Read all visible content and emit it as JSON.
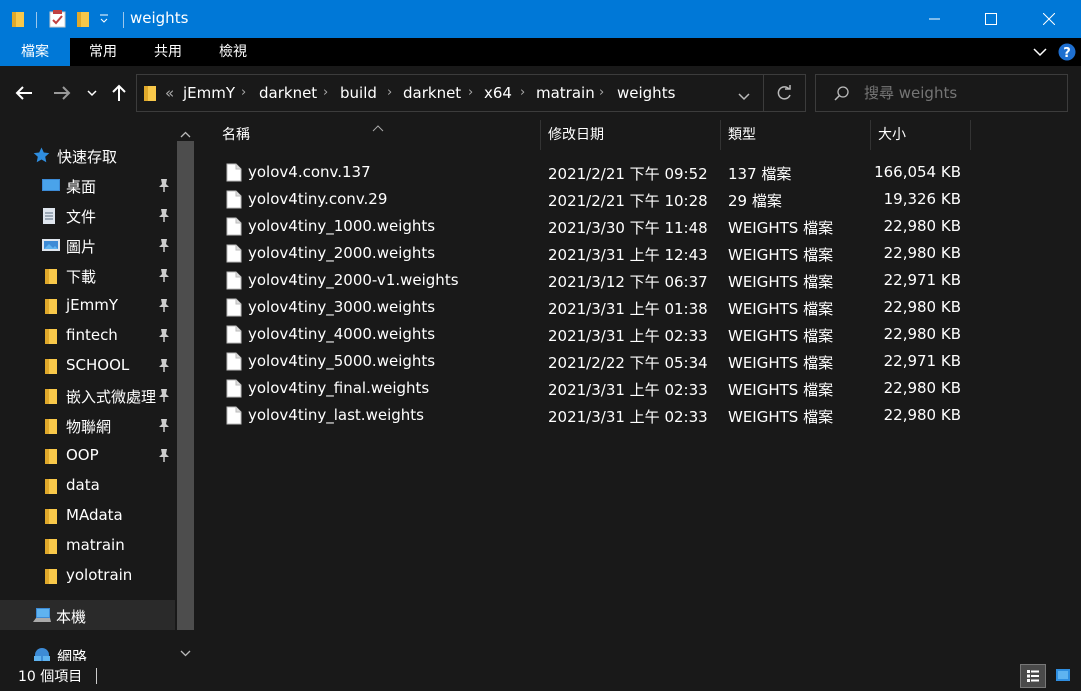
{
  "window": {
    "title": "weights"
  },
  "ribbon": {
    "tabs": [
      "檔案",
      "常用",
      "共用",
      "檢視"
    ]
  },
  "address": {
    "overflow": "«",
    "crumbs": [
      "jEmmY",
      "darknet",
      "build",
      "darknet",
      "x64",
      "matrain",
      "weights"
    ]
  },
  "search": {
    "placeholder": "搜尋 weights"
  },
  "sidebar": {
    "quick_access": "快速存取",
    "pinned": [
      {
        "label": "桌面",
        "icon": "desktop-icon"
      },
      {
        "label": "文件",
        "icon": "documents-icon"
      },
      {
        "label": "圖片",
        "icon": "pictures-icon"
      },
      {
        "label": "下載",
        "icon": "downloads-icon"
      },
      {
        "label": "jEmmY",
        "icon": "folder-icon"
      },
      {
        "label": "fintech",
        "icon": "folder-icon"
      },
      {
        "label": "SCHOOL",
        "icon": "folder-icon"
      },
      {
        "label": "嵌入式微處理",
        "icon": "folder-icon"
      },
      {
        "label": "物聯網",
        "icon": "folder-icon"
      },
      {
        "label": "OOP",
        "icon": "folder-icon"
      }
    ],
    "recent": [
      {
        "label": "data",
        "icon": "folder-icon"
      },
      {
        "label": "MAdata",
        "icon": "folder-icon"
      },
      {
        "label": "matrain",
        "icon": "folder-icon"
      },
      {
        "label": "yolotrain",
        "icon": "folder-icon"
      }
    ],
    "this_pc": "本機",
    "network": "網路"
  },
  "columns": {
    "name": "名稱",
    "date": "修改日期",
    "type": "類型",
    "size": "大小"
  },
  "files": [
    {
      "name": "yolov4.conv.137",
      "date": "2021/2/21 下午 09:52",
      "type": "137 檔案",
      "size": "166,054 KB"
    },
    {
      "name": "yolov4tiny.conv.29",
      "date": "2021/2/21 下午 10:28",
      "type": "29 檔案",
      "size": "19,326 KB"
    },
    {
      "name": "yolov4tiny_1000.weights",
      "date": "2021/3/30 下午 11:48",
      "type": "WEIGHTS 檔案",
      "size": "22,980 KB"
    },
    {
      "name": "yolov4tiny_2000.weights",
      "date": "2021/3/31 上午 12:43",
      "type": "WEIGHTS 檔案",
      "size": "22,980 KB"
    },
    {
      "name": "yolov4tiny_2000-v1.weights",
      "date": "2021/3/12 下午 06:37",
      "type": "WEIGHTS 檔案",
      "size": "22,971 KB"
    },
    {
      "name": "yolov4tiny_3000.weights",
      "date": "2021/3/31 上午 01:38",
      "type": "WEIGHTS 檔案",
      "size": "22,980 KB"
    },
    {
      "name": "yolov4tiny_4000.weights",
      "date": "2021/3/31 上午 02:33",
      "type": "WEIGHTS 檔案",
      "size": "22,980 KB"
    },
    {
      "name": "yolov4tiny_5000.weights",
      "date": "2021/2/22 下午 05:34",
      "type": "WEIGHTS 檔案",
      "size": "22,971 KB"
    },
    {
      "name": "yolov4tiny_final.weights",
      "date": "2021/3/31 上午 02:33",
      "type": "WEIGHTS 檔案",
      "size": "22,980 KB"
    },
    {
      "name": "yolov4tiny_last.weights",
      "date": "2021/3/31 上午 02:33",
      "type": "WEIGHTS 檔案",
      "size": "22,980 KB"
    }
  ],
  "status": {
    "item_count": "10 個項目"
  },
  "colors": {
    "accent": "#0078d7",
    "background": "#191919",
    "folder": "#f8c84a"
  }
}
